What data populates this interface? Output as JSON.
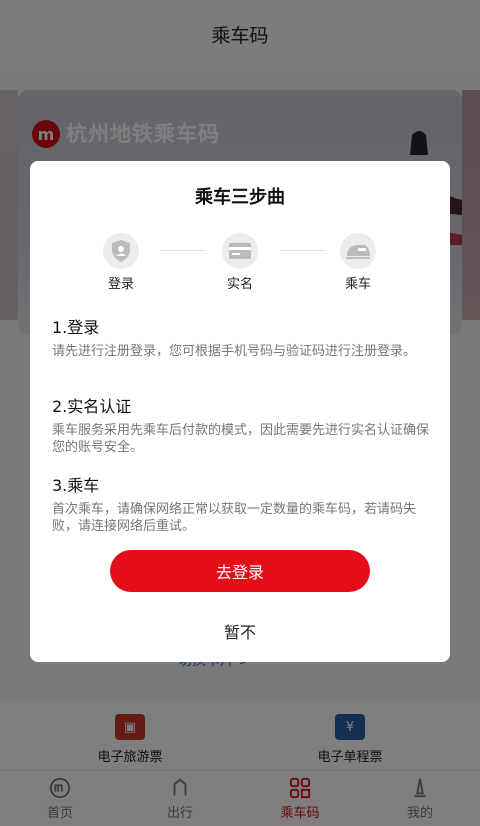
{
  "header": {
    "title": "乘车码"
  },
  "banner": {
    "logo_text": "m",
    "title": "杭州地铁乘车码"
  },
  "switch_card": {
    "label": "切换卡片 >"
  },
  "tickets": [
    {
      "label": "电子旅游票",
      "color": "#c9352b",
      "icon": "ticket-icon"
    },
    {
      "label": "电子单程票",
      "color": "#2b5fa8",
      "icon": "yuan-ticket-icon",
      "icon_glyph": "¥"
    }
  ],
  "tabbar": {
    "items": [
      {
        "label": "首页",
        "icon": "metro-logo-icon"
      },
      {
        "label": "出行",
        "icon": "travel-icon"
      },
      {
        "label": "乘车码",
        "icon": "qr-code-icon",
        "active": true
      },
      {
        "label": "我的",
        "icon": "profile-icon"
      }
    ]
  },
  "modal": {
    "title": "乘车三步曲",
    "steps": [
      {
        "label": "登录",
        "icon": "shield-user-icon"
      },
      {
        "label": "实名",
        "icon": "id-card-icon"
      },
      {
        "label": "乘车",
        "icon": "train-icon"
      }
    ],
    "sections": [
      {
        "title": "1.登录",
        "body": "请先进行注册登录，您可根据手机号码与验证码进行注册登录。"
      },
      {
        "title": "2.实名认证",
        "body": "乘车服务采用先乘车后付款的模式，因此需要先进行实名认证确保您的账号安全。"
      },
      {
        "title": "3.乘车",
        "body": "首次乘车，请确保网络正常以获取一定数量的乘车码，若请码失败，请连接网络后重试。"
      }
    ],
    "primary_button": "去登录",
    "secondary_button": "暂不"
  },
  "colors": {
    "brand": "#e30e1a",
    "link": "#2d6bd8"
  }
}
